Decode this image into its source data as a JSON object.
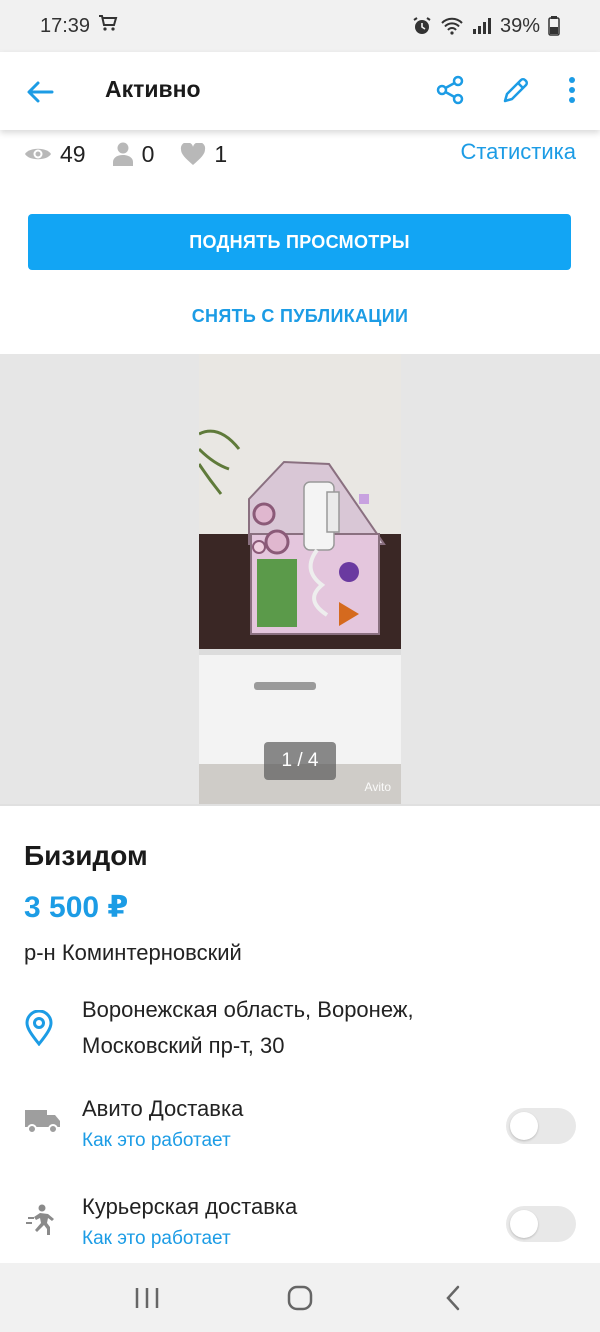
{
  "status_bar": {
    "time": "17:39",
    "battery": "39%"
  },
  "app_bar": {
    "title": "Активно"
  },
  "stats": {
    "views": "49",
    "contacts": "0",
    "favorites": "1",
    "statistics_label": "Статистика"
  },
  "actions": {
    "raise_views_label": "ПОДНЯТЬ ПРОСМОТРЫ",
    "unpublish_label": "СНЯТЬ С ПУБЛИКАЦИИ"
  },
  "gallery": {
    "counter": "1 / 4",
    "watermark": "Avito"
  },
  "ad": {
    "title": "Бизидом",
    "price": "3 500 ₽",
    "district": "р-н Коминтерновский",
    "address_line1": "Воронежская область, Воронеж,",
    "address_line2": "Московский пр-т, 30"
  },
  "delivery": [
    {
      "title": "Авито Доставка",
      "link": "Как это работает",
      "icon": "truck-icon",
      "enabled": false
    },
    {
      "title": "Курьерская доставка",
      "link": "Как это работает",
      "icon": "runner-icon",
      "enabled": false
    }
  ],
  "colors": {
    "accent": "#1c9ce5",
    "primary_button": "#12a5f4"
  }
}
